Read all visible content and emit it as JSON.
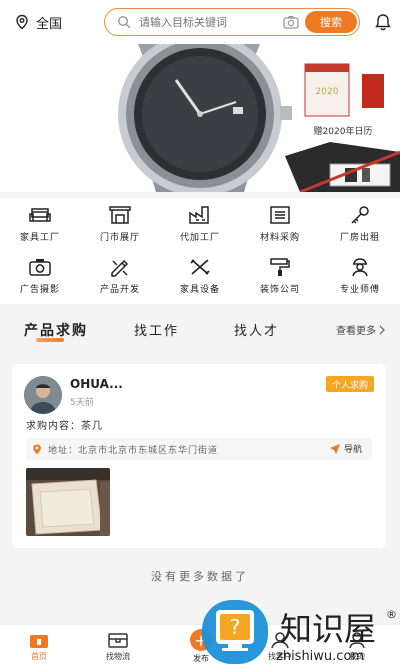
{
  "topbar": {
    "location": "全国",
    "search_placeholder": "请输入目标关键词",
    "search_button": "搜索"
  },
  "banner": {
    "calendar_caption": "赠2020年日历",
    "calendar_year": "2020"
  },
  "categories": [
    {
      "label": "家具工厂",
      "icon": "sofa-icon"
    },
    {
      "label": "门市展厅",
      "icon": "storefront-icon"
    },
    {
      "label": "代加工厂",
      "icon": "factory-icon"
    },
    {
      "label": "材料采购",
      "icon": "list-icon"
    },
    {
      "label": "厂房出租",
      "icon": "key-icon"
    },
    {
      "label": "广告摄影",
      "icon": "camera-icon"
    },
    {
      "label": "产品开发",
      "icon": "design-icon"
    },
    {
      "label": "家具设备",
      "icon": "tools-icon"
    },
    {
      "label": "装饰公司",
      "icon": "paint-roller-icon"
    },
    {
      "label": "专业师傅",
      "icon": "worker-icon"
    }
  ],
  "tabs": {
    "items": [
      "产品求购",
      "找工作",
      "找人才"
    ],
    "more": "查看更多"
  },
  "card": {
    "username": "OHUA...",
    "time": "5天前",
    "badge": "个人求购",
    "request_label": "求购内容：",
    "request_value": "茶几",
    "address_label": "地址：",
    "address": "北京市北京市东城区东华门街道",
    "nav_label": "导航"
  },
  "footer_text": "没有更多数据了",
  "bottom_nav": [
    {
      "label": "首页"
    },
    {
      "label": "找物流"
    },
    {
      "label": "发布"
    },
    {
      "label": "找客户"
    },
    {
      "label": "我的"
    }
  ],
  "watermark": {
    "title": "知识屋",
    "url": "zhishiwu.com"
  },
  "colors": {
    "accent": "#f07a22",
    "badge": "#f5a623"
  }
}
